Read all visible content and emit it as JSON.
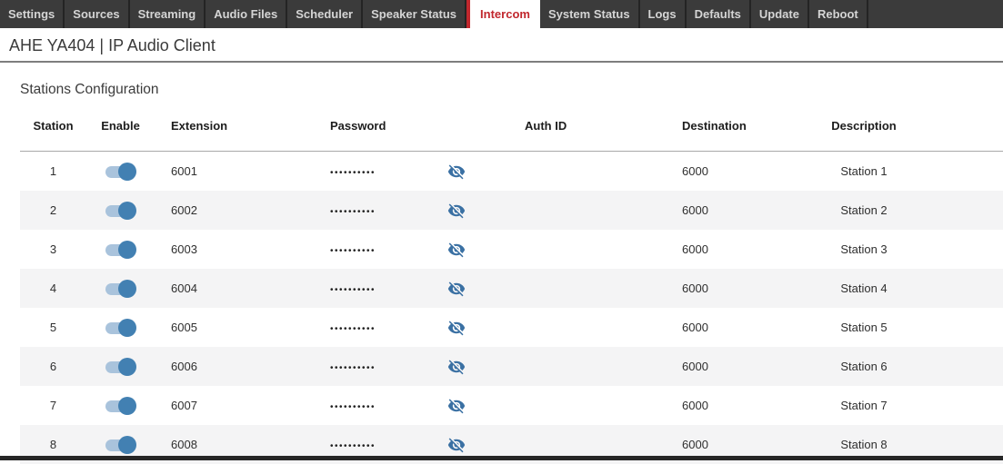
{
  "nav": {
    "tabs": [
      {
        "label": "Settings",
        "active": false
      },
      {
        "label": "Sources",
        "active": false
      },
      {
        "label": "Streaming",
        "active": false
      },
      {
        "label": "Audio Files",
        "active": false
      },
      {
        "label": "Scheduler",
        "active": false
      },
      {
        "label": "Speaker Status",
        "active": false
      },
      {
        "label": "Intercom",
        "active": true
      },
      {
        "label": "System Status",
        "active": false
      },
      {
        "label": "Logs",
        "active": false
      },
      {
        "label": "Defaults",
        "active": false
      },
      {
        "label": "Update",
        "active": false
      },
      {
        "label": "Reboot",
        "active": false
      }
    ]
  },
  "header": {
    "title": "AHE YA404 | IP Audio Client"
  },
  "section": {
    "title": "Stations Configuration"
  },
  "table": {
    "columns": {
      "station": "Station",
      "enable": "Enable",
      "extension": "Extension",
      "password": "Password",
      "auth_id": "Auth ID",
      "destination": "Destination",
      "description": "Description"
    },
    "rows": [
      {
        "station": "1",
        "enabled": true,
        "extension": "6001",
        "password_masked": "••••••••••",
        "auth_id": "",
        "destination": "6000",
        "description": "Station 1"
      },
      {
        "station": "2",
        "enabled": true,
        "extension": "6002",
        "password_masked": "••••••••••",
        "auth_id": "",
        "destination": "6000",
        "description": "Station 2"
      },
      {
        "station": "3",
        "enabled": true,
        "extension": "6003",
        "password_masked": "••••••••••",
        "auth_id": "",
        "destination": "6000",
        "description": "Station 3"
      },
      {
        "station": "4",
        "enabled": true,
        "extension": "6004",
        "password_masked": "••••••••••",
        "auth_id": "",
        "destination": "6000",
        "description": "Station 4"
      },
      {
        "station": "5",
        "enabled": true,
        "extension": "6005",
        "password_masked": "••••••••••",
        "auth_id": "",
        "destination": "6000",
        "description": "Station 5"
      },
      {
        "station": "6",
        "enabled": true,
        "extension": "6006",
        "password_masked": "••••••••••",
        "auth_id": "",
        "destination": "6000",
        "description": "Station 6"
      },
      {
        "station": "7",
        "enabled": true,
        "extension": "6007",
        "password_masked": "••••••••••",
        "auth_id": "",
        "destination": "6000",
        "description": "Station 7"
      },
      {
        "station": "8",
        "enabled": true,
        "extension": "6008",
        "password_masked": "••••••••••",
        "auth_id": "",
        "destination": "6000",
        "description": "Station 8"
      }
    ]
  },
  "icons": {
    "password_visibility": "eye-slash-icon"
  },
  "colors": {
    "nav_background": "#3b3b3b",
    "active_tab_accent": "#c1272d",
    "toggle_track": "#a9c3dc",
    "toggle_knob": "#4280b2",
    "eye_icon": "#3a70a3",
    "row_stripe": "#f4f4f5"
  }
}
